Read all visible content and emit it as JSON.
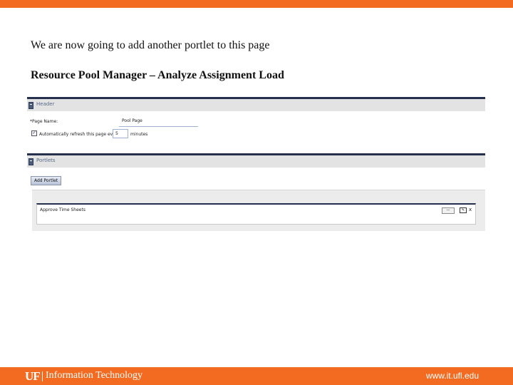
{
  "slide": {
    "intro": "We are now going to add another portlet to this page",
    "heading": "Resource Pool Manager – Analyze Assignment Load"
  },
  "header_section": {
    "title": "Header",
    "page_name_label": "*Page Name:",
    "page_name_value": "Pool Page",
    "refresh_checked": true,
    "refresh_label": "Automatically refresh this page every",
    "refresh_value": "5",
    "minutes_label": "minutes"
  },
  "portlets_section": {
    "title": "Portlets",
    "add_button": "Add Portlet",
    "portlet_title": "Approve Time Sheets",
    "select_label": "—",
    "edit_icon": "edit-icon",
    "close_icon": "close-icon",
    "close_glyph": "x"
  },
  "footer": {
    "logo_mark": "UF",
    "logo_text": "Information Technology",
    "url": "www.it.ufl.edu"
  },
  "colors": {
    "accent": "#f26b21",
    "section_border": "#24304d",
    "section_bg": "#e3e3e3"
  }
}
